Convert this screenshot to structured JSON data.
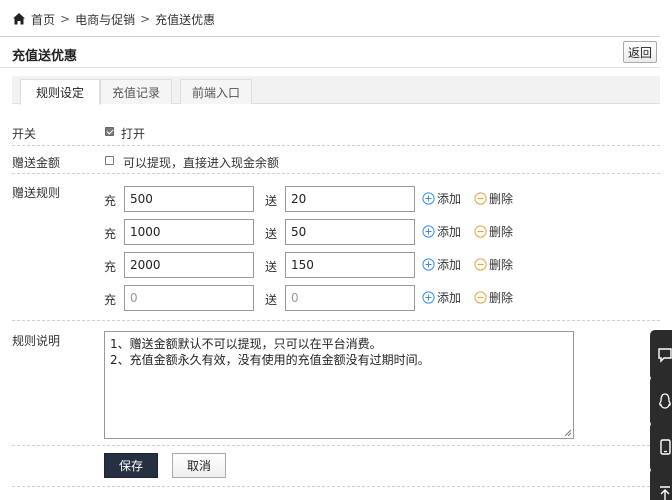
{
  "breadcrumb": {
    "items": [
      "首页",
      "电商与促销",
      "充值送优惠"
    ],
    "separator": ">"
  },
  "header": {
    "title": "充值送优惠",
    "back_label": "返回"
  },
  "tabs": [
    {
      "label": "规则设定",
      "active": true
    },
    {
      "label": "充值记录",
      "active": false
    },
    {
      "label": "前端入口",
      "active": false
    }
  ],
  "form": {
    "switch": {
      "label": "开关",
      "option": "打开",
      "checked": true
    },
    "bonus": {
      "label": "赠送金额",
      "option": "可以提现，直接进入现金余额",
      "checked": false
    },
    "rules": {
      "label": "赠送规则",
      "prefix": "充",
      "middle": "送",
      "add_label": "添加",
      "delete_label": "删除",
      "rows": [
        {
          "charge": "500",
          "gift": "20"
        },
        {
          "charge": "1000",
          "gift": "50"
        },
        {
          "charge": "2000",
          "gift": "150"
        },
        {
          "charge": "",
          "gift": "",
          "charge_placeholder": "0",
          "gift_placeholder": "0"
        }
      ]
    },
    "description": {
      "label": "规则说明",
      "lines": [
        "1、赠送金额默认不可以提现，只可以在平台消费。",
        "2、充值金额永久有效，没有使用的充值金额没有过期时间。"
      ]
    }
  },
  "actions": {
    "save_label": "保存",
    "cancel_label": "取消"
  },
  "colors": {
    "accent_icon": "#3a8ee6",
    "delete_icon": "#e0a73a",
    "primary_button": "#253142",
    "float_bar": "#2b2b2b"
  },
  "float_bar_icons": [
    "chat-icon",
    "qq-icon",
    "phone-icon",
    "back-to-top-icon"
  ]
}
